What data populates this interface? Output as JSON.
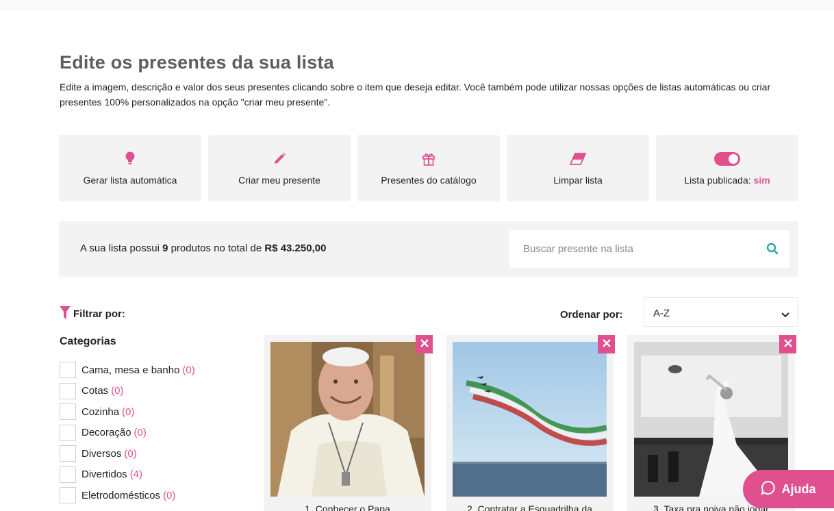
{
  "header": {
    "title": "Edite os presentes da sua lista",
    "description": "Edite a imagem, descrição e valor dos seus presentes clicando sobre o item que deseja editar. Você também pode utilizar nossas opções de listas automáticas ou criar presentes 100% personalizados na opção \"criar meu presente\"."
  },
  "actions": [
    {
      "label": "Gerar lista automática",
      "icon": "lightbulb-icon"
    },
    {
      "label": "Criar meu presente",
      "icon": "pencil-icon"
    },
    {
      "label": "Presentes do catálogo",
      "icon": "gift-icon"
    },
    {
      "label": "Limpar lista",
      "icon": "eraser-icon"
    },
    {
      "label_prefix": "Lista publicada: ",
      "label_value": "sim",
      "icon": "toggle-icon",
      "toggle_on": true
    }
  ],
  "summary": {
    "prefix": "A sua lista possui ",
    "count": "9",
    "middle": " produtos no total de ",
    "total": "R$ 43.250,00",
    "search_placeholder": "Buscar presente na lista"
  },
  "filter": {
    "title": "Filtrar por:",
    "categories_title": "Categorias",
    "categories": [
      {
        "label": "Cama, mesa e banho",
        "count": "(0)"
      },
      {
        "label": "Cotas",
        "count": "(0)"
      },
      {
        "label": "Cozinha",
        "count": "(0)"
      },
      {
        "label": "Decoração",
        "count": "(0)"
      },
      {
        "label": "Diversos",
        "count": "(0)"
      },
      {
        "label": "Divertidos",
        "count": "(4)"
      },
      {
        "label": "Eletrodomésticos",
        "count": "(0)"
      }
    ]
  },
  "sort": {
    "label": "Ordenar por:",
    "selected": "A-Z"
  },
  "products": [
    {
      "caption": "1. Conhecer o Papa"
    },
    {
      "caption": "2. Contratar a Esquadrilha da"
    },
    {
      "caption": "3. Taxa pra noiva não jogar"
    }
  ],
  "help": {
    "label": "Ajuda"
  },
  "colors": {
    "accent": "#e0508f",
    "panel": "#f3f3f3"
  }
}
